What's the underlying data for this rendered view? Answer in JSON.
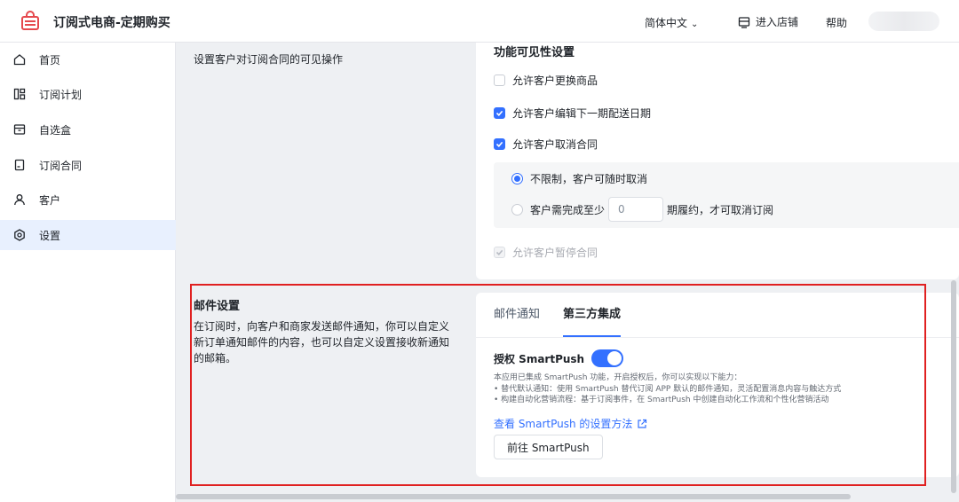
{
  "header": {
    "app_title": "订阅式电商-定期购买",
    "language": "简体中文",
    "store_link": "进入店铺",
    "help": "帮助"
  },
  "sidebar": {
    "items": [
      {
        "label": "首页",
        "icon": "home-icon"
      },
      {
        "label": "订阅计划",
        "icon": "plan-icon"
      },
      {
        "label": "自选盒",
        "icon": "box-icon"
      },
      {
        "label": "订阅合同",
        "icon": "contract-icon"
      },
      {
        "label": "客户",
        "icon": "user-icon"
      },
      {
        "label": "设置",
        "icon": "settings-icon"
      }
    ],
    "active_index": 5
  },
  "visibility": {
    "description": "设置客户对订阅合同的可见操作",
    "title": "功能可见性设置",
    "options": [
      {
        "label": "允许客户更换商品",
        "checked": false
      },
      {
        "label": "允许客户编辑下一期配送日期",
        "checked": true
      },
      {
        "label": "允许客户取消合同",
        "checked": true
      }
    ],
    "cancel_rules": {
      "unlimited": "不限制，客户可随时取消",
      "min_prefix": "客户需完成至少",
      "min_value": "0",
      "min_suffix": "期履约，才可取消订阅"
    },
    "pause_option": "允许客户暂停合同"
  },
  "email": {
    "title": "邮件设置",
    "description": "在订阅时，向客户和商家发送邮件通知，你可以自定义新订单通知邮件的内容，也可以自定义设置接收新通知的邮箱。",
    "tabs": [
      "邮件通知",
      "第三方集成"
    ],
    "active_tab": 1,
    "auth_label": "授权 SmartPush",
    "info_lines": [
      "本应用已集成 SmartPush 功能，开启授权后，你可以实现以下能力：",
      "• 替代默认通知：使用 SmartPush 替代订阅 APP 默认的邮件通知，灵活配置消息内容与触达方式",
      "• 构建自动化营销流程：基于订阅事件，在 SmartPush 中创建自动化工作流和个性化营销活动"
    ],
    "link_text": "查看 SmartPush 的设置方法",
    "button_label": "前往 SmartPush"
  },
  "colors": {
    "accent": "#3370ff",
    "highlight": "#e02020",
    "logo": "#e5484d"
  }
}
